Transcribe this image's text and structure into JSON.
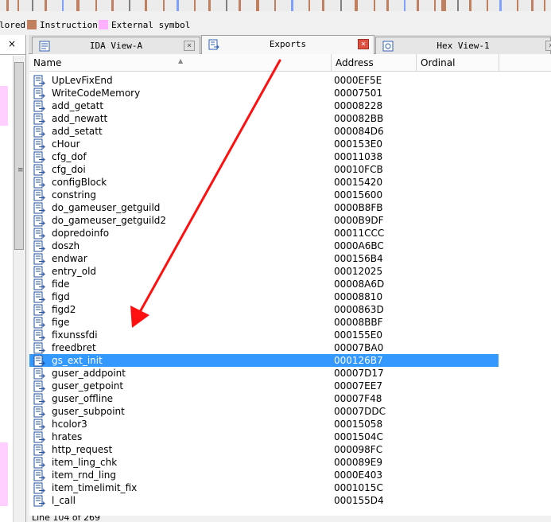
{
  "legend": {
    "items": [
      {
        "label": "lored",
        "color": null
      },
      {
        "label": "Instruction",
        "color": "#c08060"
      },
      {
        "label": "External symbol",
        "color": "#ffb0ff"
      }
    ]
  },
  "left_panel": {
    "close_glyph": "×",
    "grip_glyph": "≡"
  },
  "tabs": [
    {
      "label": "IDA View-A",
      "icon": "ida-view-icon",
      "active": false,
      "close_glyph": "×"
    },
    {
      "label": "Exports",
      "icon": "exports-icon",
      "active": true,
      "close_glyph": "×"
    },
    {
      "label": "Hex View-1",
      "icon": "hex-view-icon",
      "active": false,
      "close_glyph": "×"
    }
  ],
  "exports": {
    "columns": [
      "Name",
      "Address",
      "Ordinal"
    ],
    "selected_index": 22,
    "rows": [
      {
        "name": "UpLevFixEnd",
        "address": "0000EF5E"
      },
      {
        "name": "WriteCodeMemory",
        "address": "00007501"
      },
      {
        "name": "add_getatt",
        "address": "00008228"
      },
      {
        "name": "add_newatt",
        "address": "000082BB"
      },
      {
        "name": "add_setatt",
        "address": "000084D6"
      },
      {
        "name": "cHour",
        "address": "000153E0"
      },
      {
        "name": "cfg_dof",
        "address": "00011038"
      },
      {
        "name": "cfg_doi",
        "address": "00010FCB"
      },
      {
        "name": "configBlock",
        "address": "00015420"
      },
      {
        "name": "constring",
        "address": "00015600"
      },
      {
        "name": "do_gameuser_getguild",
        "address": "0000B8FB"
      },
      {
        "name": "do_gameuser_getguild2",
        "address": "0000B9DF"
      },
      {
        "name": "dopredoinfo",
        "address": "00011CCC"
      },
      {
        "name": "doszh",
        "address": "0000A6BC"
      },
      {
        "name": "endwar",
        "address": "000156B4"
      },
      {
        "name": "entry_old",
        "address": "00012025"
      },
      {
        "name": "fide",
        "address": "00008A6D"
      },
      {
        "name": "figd",
        "address": "00008810"
      },
      {
        "name": "figd2",
        "address": "0000863D"
      },
      {
        "name": "fige",
        "address": "00008BBF"
      },
      {
        "name": "fixunssfdi",
        "address": "000155E0"
      },
      {
        "name": "freedbret",
        "address": "00007BA0"
      },
      {
        "name": "gs_ext_init",
        "address": "000126B7"
      },
      {
        "name": "guser_addpoint",
        "address": "00007D17"
      },
      {
        "name": "guser_getpoint",
        "address": "00007EE7"
      },
      {
        "name": "guser_offline",
        "address": "00007F48"
      },
      {
        "name": "guser_subpoint",
        "address": "00007DDC"
      },
      {
        "name": "hcolor3",
        "address": "00015058"
      },
      {
        "name": "hrates",
        "address": "0001504C"
      },
      {
        "name": "http_request",
        "address": "000098FC"
      },
      {
        "name": "item_ling_chk",
        "address": "000089E9"
      },
      {
        "name": "item_rnd_ling",
        "address": "0000E403"
      },
      {
        "name": "item_timelimit_fix",
        "address": "0001015C"
      },
      {
        "name": "l_call",
        "address": "000155D4"
      }
    ]
  },
  "status": {
    "line": "Line 104 of 269"
  },
  "colors": {
    "selection": "#3399ff",
    "annotation_arrow": "#ff1010",
    "external_symbol": "#ffb0ff",
    "instruction": "#c08060"
  }
}
